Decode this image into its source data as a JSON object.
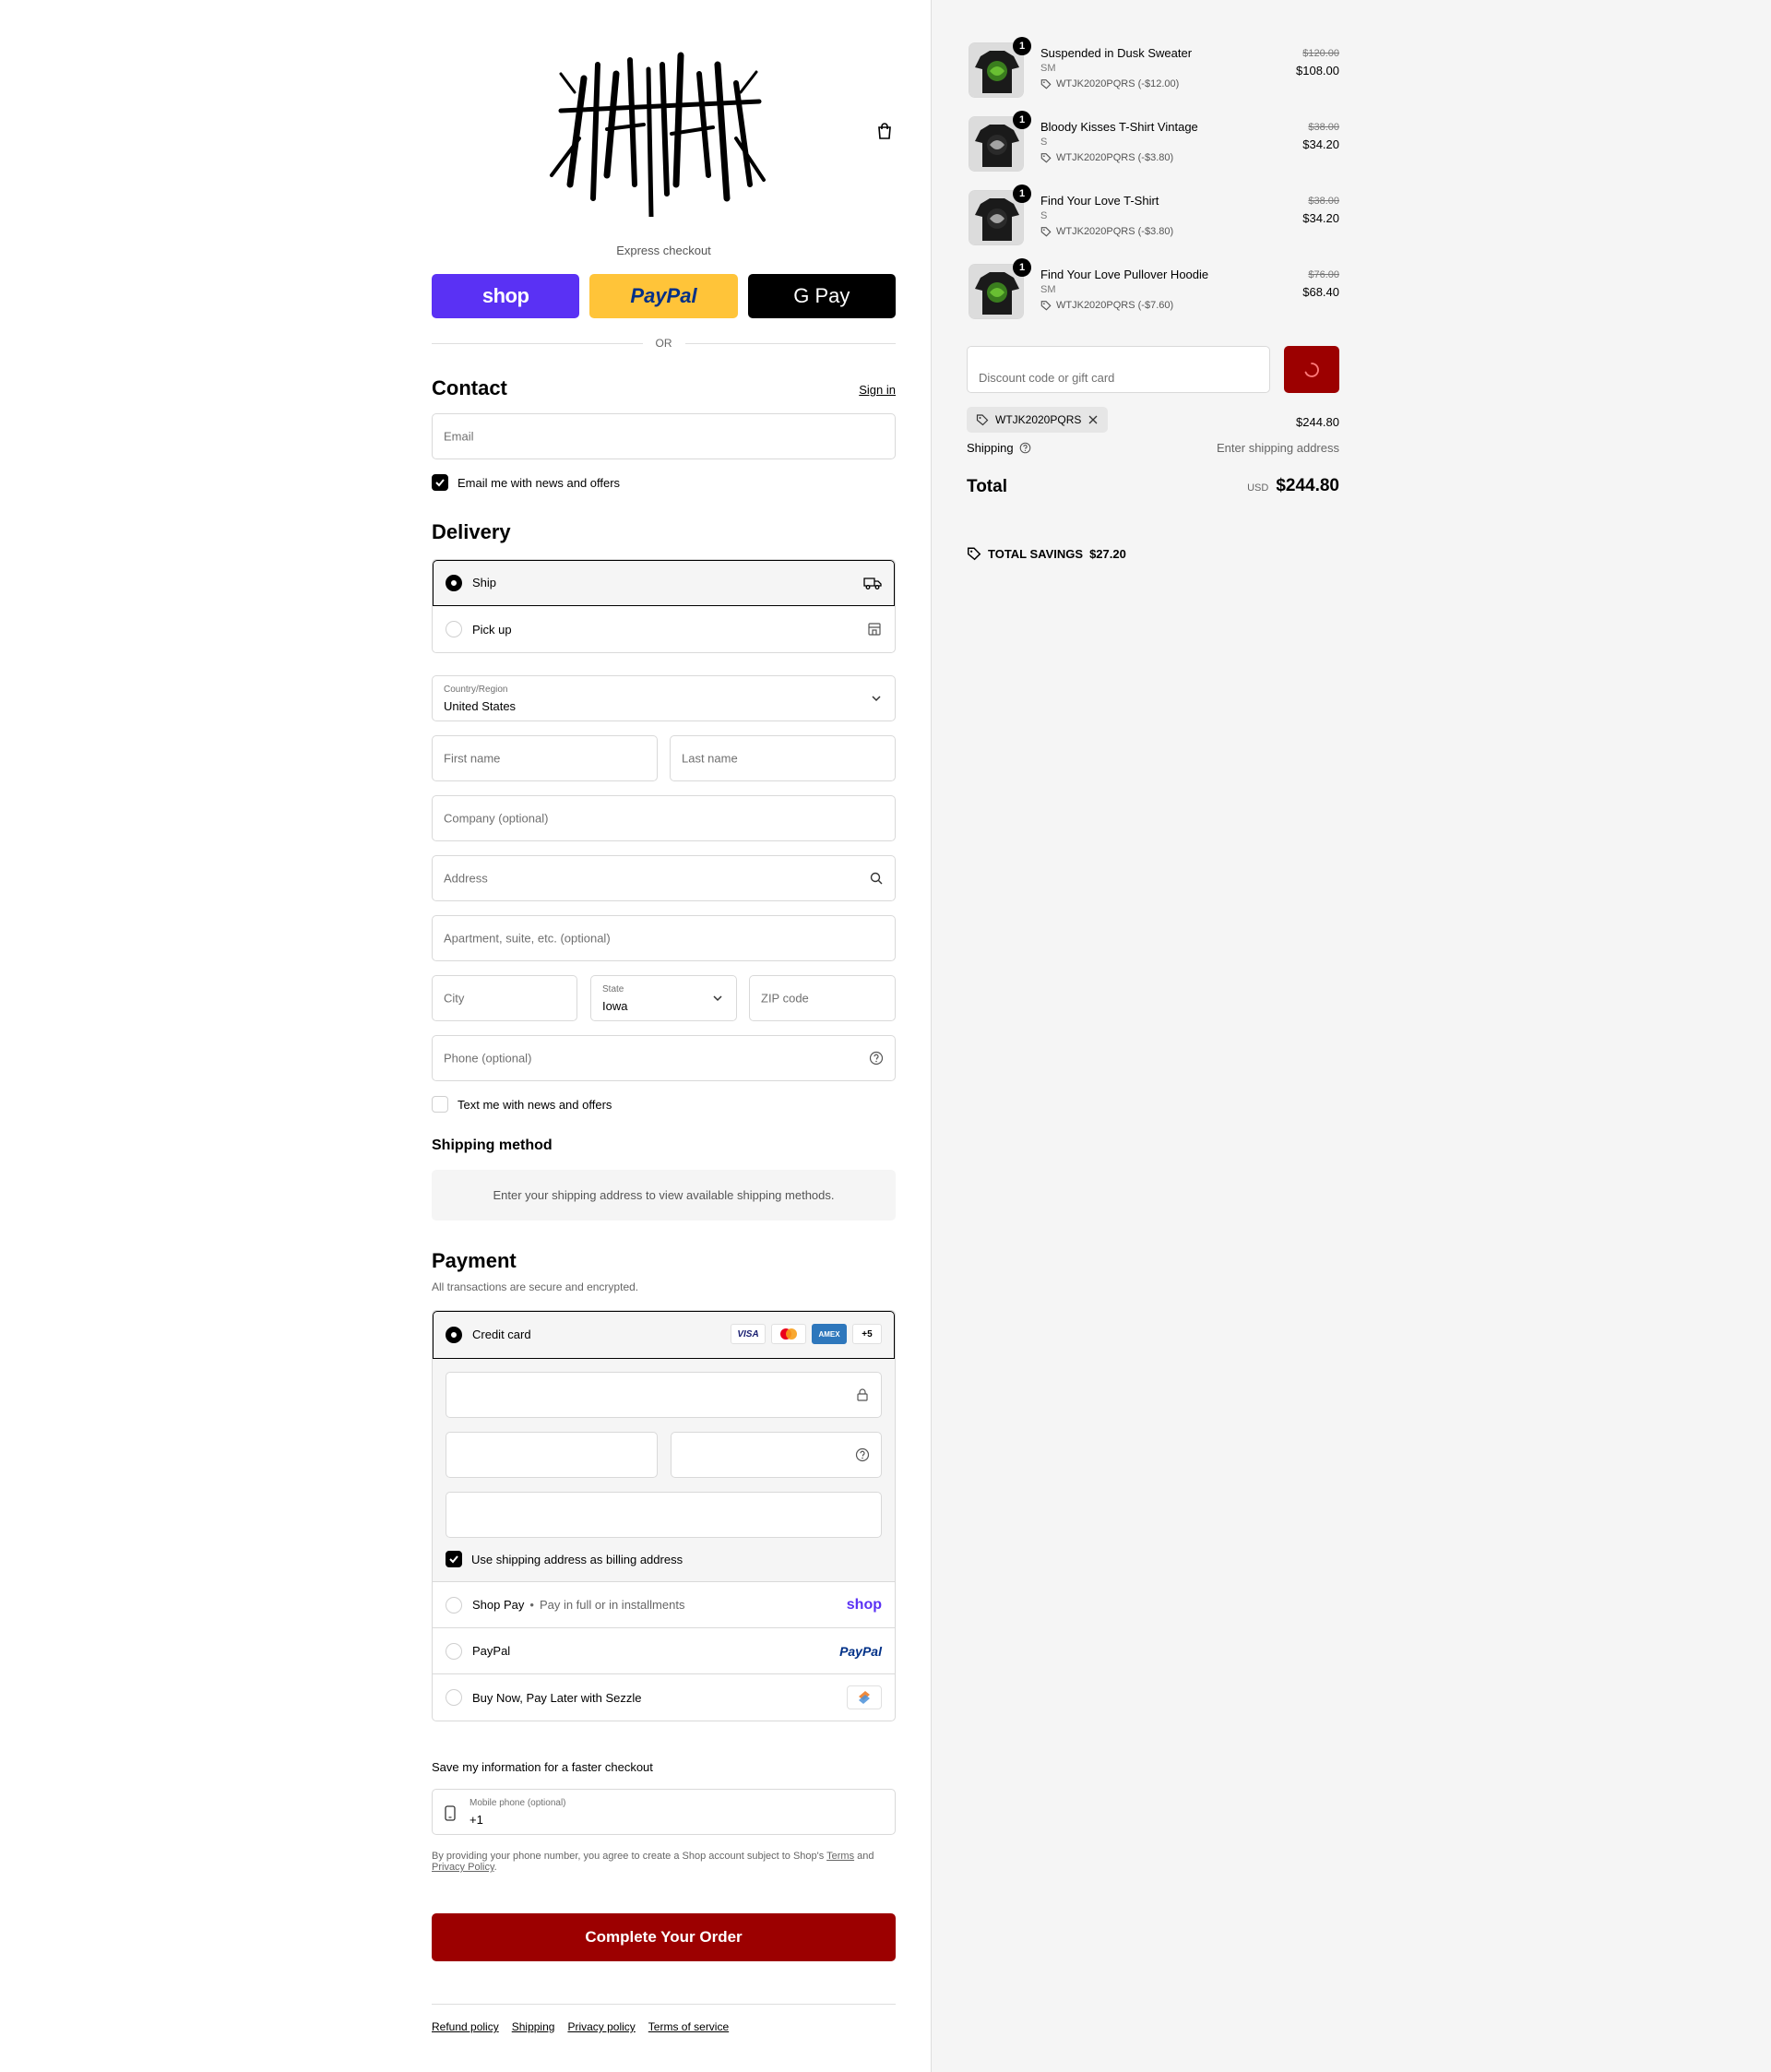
{
  "header": {
    "brand": "Hunter",
    "cart_icon": "shopping-bag-icon"
  },
  "express": {
    "label": "Express checkout",
    "shop_label": "shop",
    "paypal_label": "PayPal",
    "gpay_label": "G Pay",
    "or_label": "OR"
  },
  "contact": {
    "title": "Contact",
    "sign_in": "Sign in",
    "email_placeholder": "Email",
    "news_label": "Email me with news and offers",
    "news_checked": true
  },
  "delivery": {
    "title": "Delivery",
    "ship_label": "Ship",
    "pickup_label": "Pick up",
    "country_label": "Country/Region",
    "country_value": "United States",
    "first_name_ph": "First name",
    "last_name_ph": "Last name",
    "company_ph": "Company (optional)",
    "address_ph": "Address",
    "apartment_ph": "Apartment, suite, etc. (optional)",
    "city_ph": "City",
    "state_label": "State",
    "state_value": "Iowa",
    "zip_ph": "ZIP code",
    "phone_ph": "Phone (optional)",
    "text_label": "Text me with news and offers"
  },
  "shipping_method": {
    "title": "Shipping method",
    "note": "Enter your shipping address to view available shipping methods."
  },
  "payment": {
    "title": "Payment",
    "subtitle": "All transactions are secure and encrypted.",
    "credit_card_label": "Credit card",
    "card_brands": [
      "VISA",
      "MC",
      "AMEX",
      "+5"
    ],
    "billing_label": "Use shipping address as billing address",
    "shop_pay_label": "Shop Pay",
    "shop_pay_sub": "Pay in full or in installments",
    "shop_pay_logo": "shop",
    "paypal_label": "PayPal",
    "paypal_logo": "PayPal",
    "sezzle_label": "Buy Now, Pay Later with Sezzle"
  },
  "save_info": {
    "title": "Save my information for a faster checkout",
    "mobile_label": "Mobile phone (optional)",
    "mobile_value": "+1",
    "legal_prefix": "By providing your phone number, you agree to create a Shop account subject to Shop's",
    "terms": "Terms",
    "and": "and",
    "privacy": "Privacy Policy",
    "period": "."
  },
  "complete_button": "Complete Your Order",
  "footer": [
    "Refund policy",
    "Shipping",
    "Privacy policy",
    "Terms of service"
  ],
  "cart": {
    "items": [
      {
        "name": "Suspended in Dusk Sweater",
        "variant": "SM",
        "discount": "WTJK2020PQRS (-$12.00)",
        "original": "$120.00",
        "price": "$108.00",
        "qty": "1",
        "tone": "green"
      },
      {
        "name": "Bloody Kisses T-Shirt Vintage",
        "variant": "S",
        "discount": "WTJK2020PQRS (-$3.80)",
        "original": "$38.00",
        "price": "$34.20",
        "qty": "1",
        "tone": "dark"
      },
      {
        "name": "Find Your Love T-Shirt",
        "variant": "S",
        "discount": "WTJK2020PQRS (-$3.80)",
        "original": "$38.00",
        "price": "$34.20",
        "qty": "1",
        "tone": "dark"
      },
      {
        "name": "Find Your Love Pullover Hoodie",
        "variant": "SM",
        "discount": "WTJK2020PQRS (-$7.60)",
        "original": "$76.00",
        "price": "$68.40",
        "qty": "1",
        "tone": "green"
      }
    ],
    "discount_placeholder": "Discount code or gift card",
    "applied_code": "WTJK2020PQRS",
    "subtotal": "$244.80",
    "shipping_label": "Shipping",
    "shipping_value": "Enter shipping address",
    "total_label": "Total",
    "currency": "USD",
    "total": "$244.80",
    "savings_label": "TOTAL SAVINGS",
    "savings_value": "$27.20"
  },
  "colors": {
    "accent": "#9c0000",
    "shop_purple": "#5a31f4",
    "paypal_yellow": "#ffc439"
  }
}
